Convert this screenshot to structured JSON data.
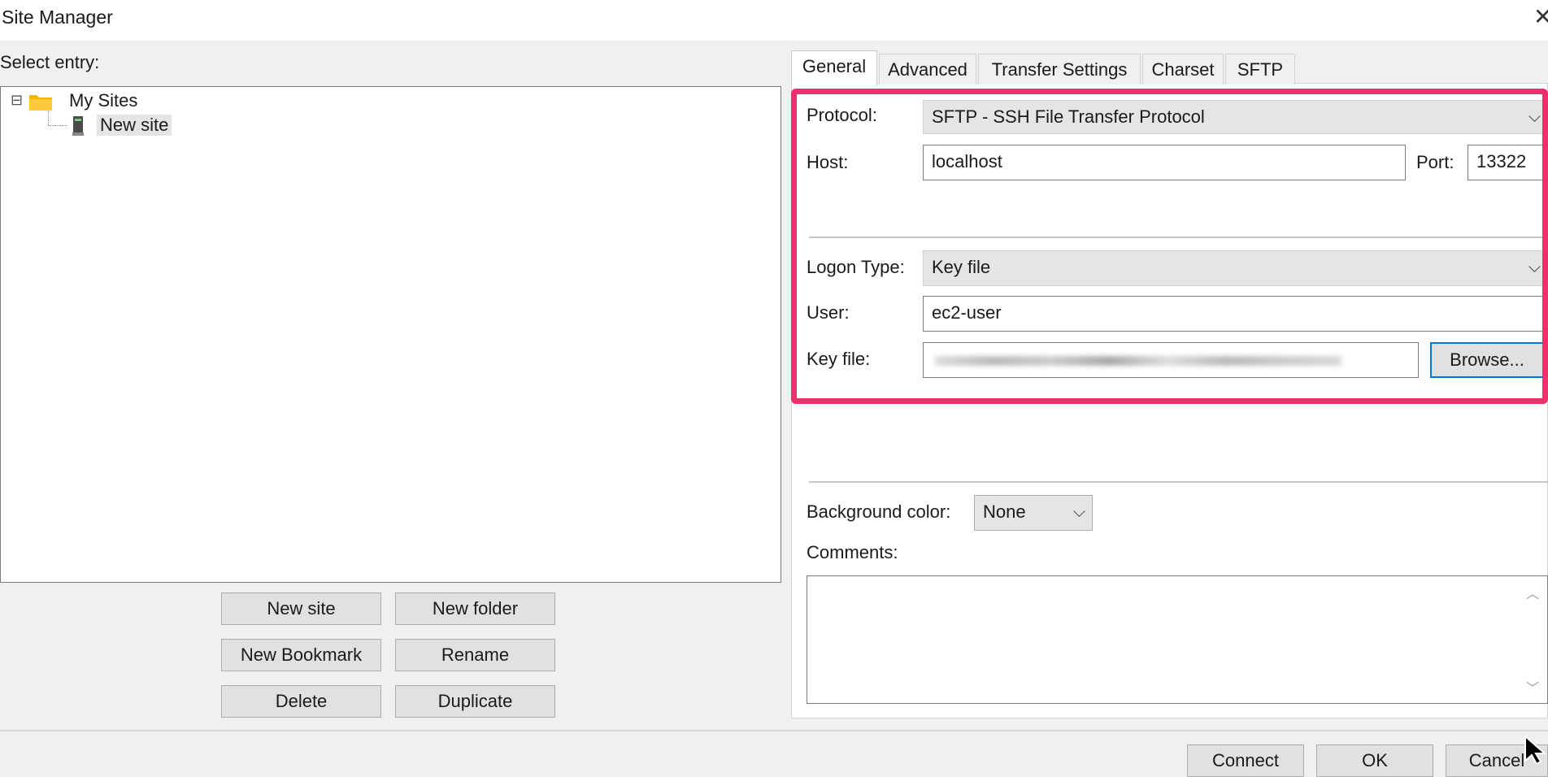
{
  "window": {
    "title": "Site Manager",
    "close_glyph": "✕"
  },
  "left": {
    "select_entry_label": "Select entry:",
    "tree": {
      "expander": "⊟",
      "root_label": "My Sites",
      "child_label": "New site"
    },
    "buttons": {
      "new_site": "New site",
      "new_folder": "New folder",
      "new_bookmark": "New Bookmark",
      "rename": "Rename",
      "delete": "Delete",
      "duplicate": "Duplicate"
    }
  },
  "tabs": [
    "General",
    "Advanced",
    "Transfer Settings",
    "Charset",
    "SFTP"
  ],
  "general": {
    "protocol_label": "Protocol:",
    "protocol_value": "SFTP - SSH File Transfer Protocol",
    "host_label": "Host:",
    "host_value": "localhost",
    "port_label": "Port:",
    "port_value": "13322",
    "logon_type_label": "Logon Type:",
    "logon_type_value": "Key file",
    "user_label": "User:",
    "user_value": "ec2-user",
    "key_file_label": "Key file:",
    "browse_label": "Browse...",
    "background_color_label": "Background color:",
    "background_color_value": "None",
    "comments_label": "Comments:"
  },
  "footer": {
    "connect": "Connect",
    "ok": "OK",
    "cancel": "Cancel"
  },
  "colors": {
    "highlight": "#f0306c",
    "folder": "#f4b400"
  }
}
